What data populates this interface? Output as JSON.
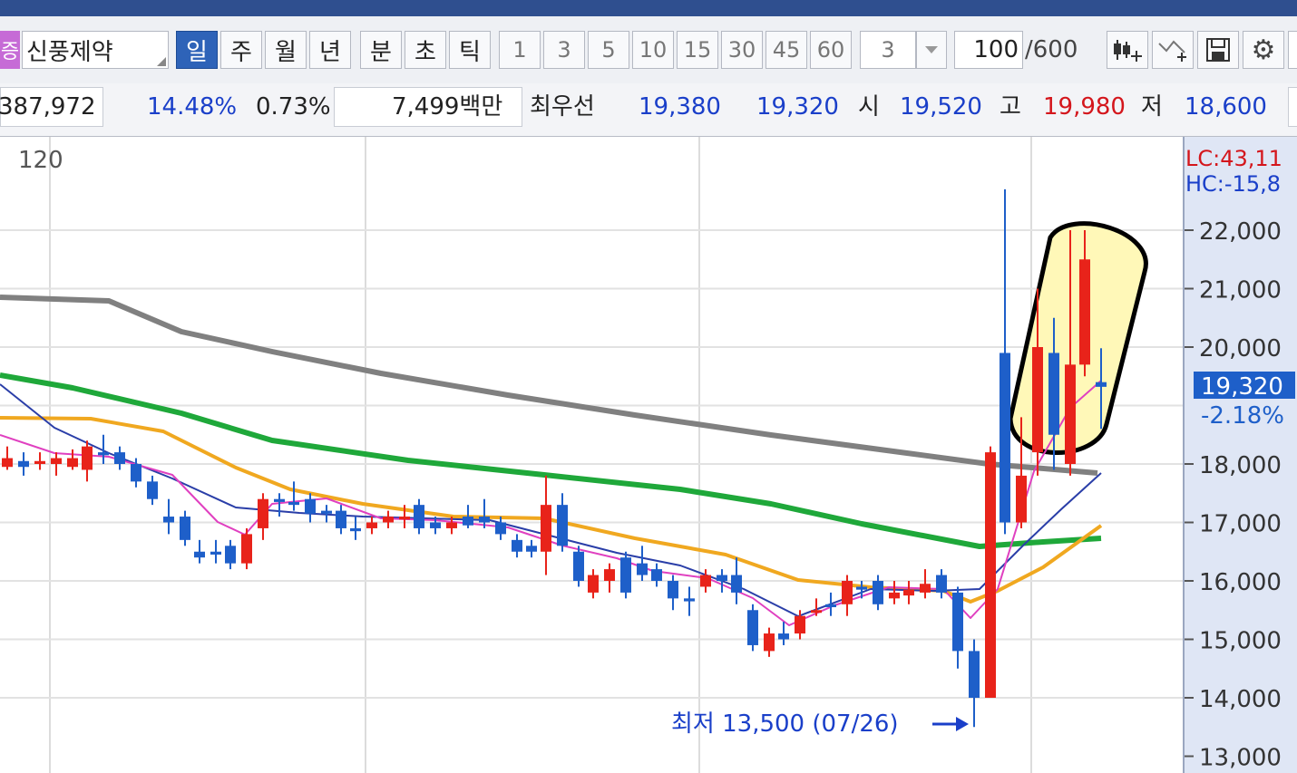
{
  "toolbar": {
    "stock_badge": "증",
    "stock_name": "신풍제약",
    "periods": [
      "일",
      "주",
      "월",
      "년",
      "분",
      "초",
      "틱"
    ],
    "selected_period": "일",
    "intervals": [
      "1",
      "3",
      "5",
      "10",
      "15",
      "30",
      "45",
      "60"
    ],
    "interval_select": "3",
    "count": "100",
    "count_max": "/600"
  },
  "info": {
    "volume": "387,972",
    "change_rate": "14.48%",
    "turnover": "0.73%",
    "amount": "7,499백만",
    "best_label": "최우선",
    "best_ask": "19,380",
    "best_bid": "19,320",
    "open_label": "시",
    "open": "19,520",
    "high_label": "고",
    "high": "19,980",
    "low_label": "저",
    "low": "18,600"
  },
  "chart": {
    "ma_period_label": "120",
    "lc": "LC:43,11",
    "hc": "HC:-15,8",
    "price_ticks": [
      "22,000",
      "21,000",
      "20,000",
      "18,000",
      "17,000",
      "16,000",
      "15,000",
      "14,000",
      "13,000"
    ],
    "current_price": "19,320",
    "current_change": "-2.18%",
    "low_annotation": "최저 13,500 (07/26)",
    "colors": {
      "up": "#e8231a",
      "down": "#1e5fc9",
      "ma5": "#e040c0",
      "ma10": "#2a3ea8",
      "ma20": "#f0a820",
      "ma60": "#1fa83a",
      "ma120": "#808080",
      "highlight": "#fff8b8"
    }
  }
}
